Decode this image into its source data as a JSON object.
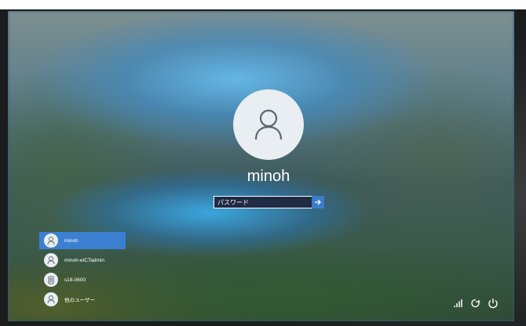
{
  "login": {
    "username": "minoh",
    "password_placeholder": "パスワード"
  },
  "users": [
    {
      "name": "minoh",
      "selected": true
    },
    {
      "name": "minoh-eICTadmin",
      "selected": false
    },
    {
      "name": "s18-0600",
      "selected": false
    },
    {
      "name": "他のユーザー",
      "selected": false
    }
  ],
  "tray_icons": [
    "network-icon",
    "ease-of-access-icon",
    "power-icon"
  ],
  "colors": {
    "accent": "#3b80d0",
    "submit": "#3a7dc9",
    "avatar_bg": "#e8eef1"
  }
}
